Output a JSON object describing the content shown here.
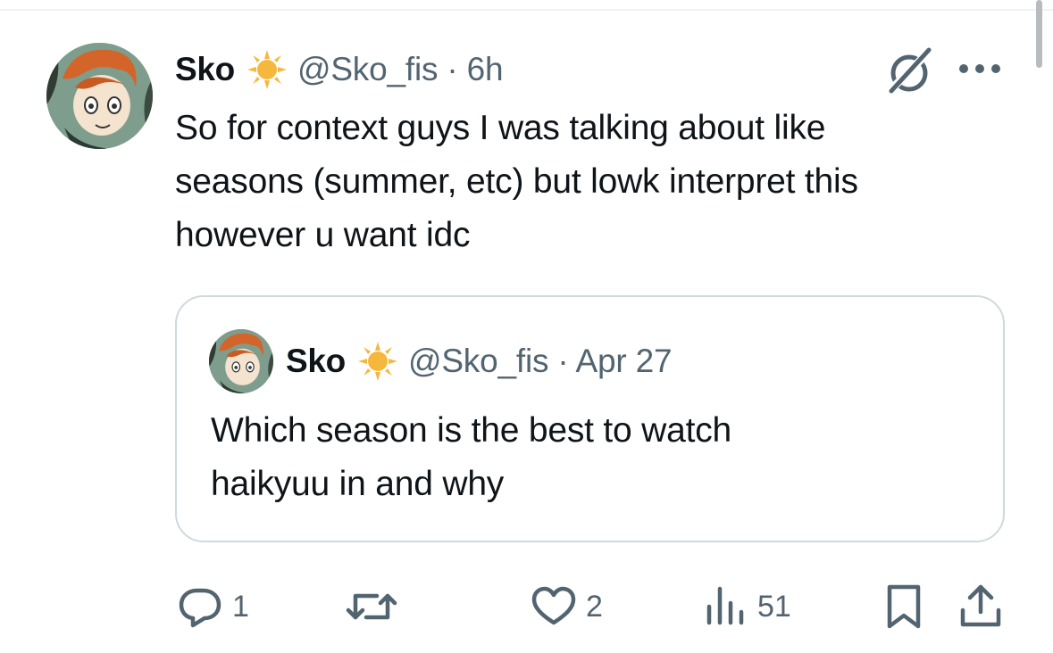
{
  "tweet": {
    "author_name": "Sko",
    "handle": "@Sko_fis",
    "separator": "·",
    "time": "6h",
    "text": "So for context guys I was talking about like\nseasons (summer, etc) but lowk interpret this\nhowever u want idc"
  },
  "quoted_tweet": {
    "author_name": "Sko",
    "handle": "@Sko_fis",
    "separator": "·",
    "time": "Apr 27",
    "text": "Which season is the best to watch\nhaikyuu in and why"
  },
  "actions": {
    "reply_count": "1",
    "repost_count": "",
    "like_count": "2",
    "views_count": "51"
  },
  "icons": {
    "badge": "sun-badge-icon",
    "grok": "grok-icon",
    "more": "more-dots-icon",
    "reply": "reply-icon",
    "repost": "repost-icon",
    "like": "heart-icon",
    "views": "views-icon",
    "bookmark": "bookmark-icon",
    "share": "share-icon"
  },
  "colors": {
    "text": "#0f1419",
    "secondary": "#536471",
    "border": "#cfd9de",
    "badge": "#f5b83c"
  }
}
